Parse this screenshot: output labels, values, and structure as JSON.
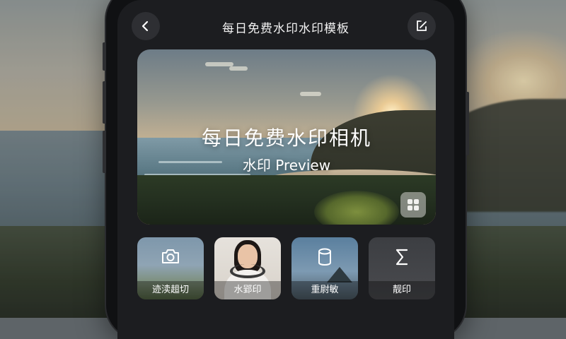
{
  "header": {
    "title": "每日免费水印水印模板",
    "back_icon": "chevron-left-icon",
    "edit_icon": "edit-icon"
  },
  "hero": {
    "title": "每日免费水印相机",
    "subtitle": "水印 Preview",
    "badge_icon": "face-grid-icon"
  },
  "cards": [
    {
      "label": "迹渎趄切",
      "icon": "camera-icon"
    },
    {
      "label": "水郢印",
      "icon": ""
    },
    {
      "label": "重尉敏",
      "icon": "cylinder-icon"
    },
    {
      "label": "靓印",
      "icon": "sigma-icon"
    }
  ],
  "colors": {
    "screen_bg": "#1c1d20",
    "button_bg": "#2e2f33",
    "text": "#ffffff"
  }
}
